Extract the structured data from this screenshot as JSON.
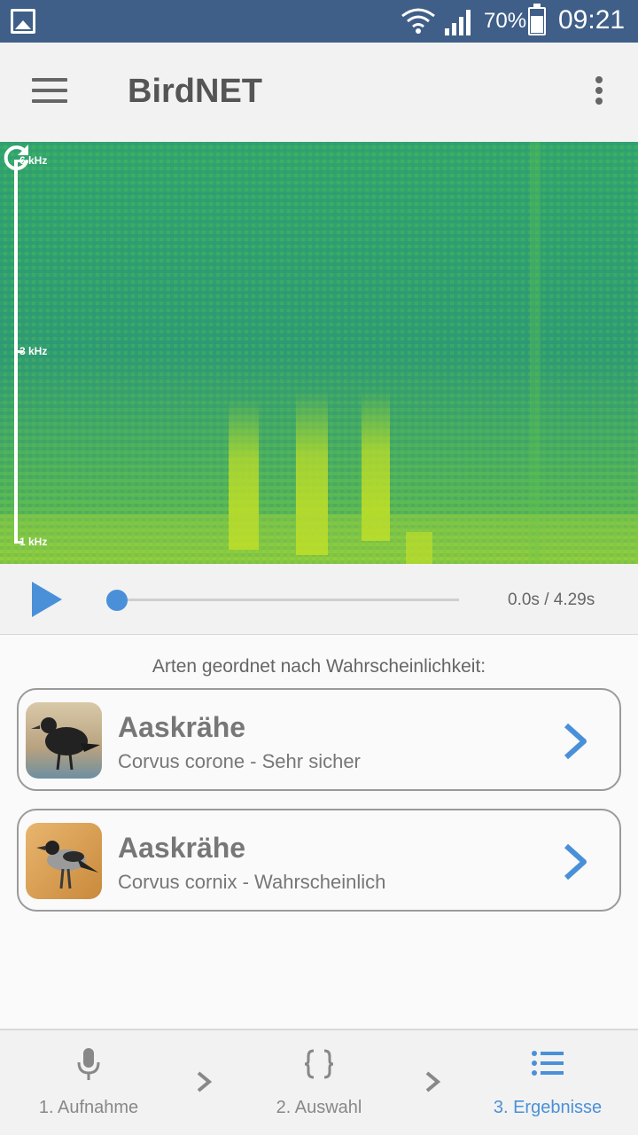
{
  "status_bar": {
    "battery": "70%",
    "time": "09:21"
  },
  "app_bar": {
    "title": "BirdNET"
  },
  "spectrogram": {
    "freq_labels": [
      "6 kHz",
      "3 kHz",
      "1 kHz"
    ]
  },
  "player": {
    "time": "0.0s / 4.29s",
    "progress": 0
  },
  "results": {
    "heading": "Arten geordnet nach Wahrscheinlichkeit:",
    "items": [
      {
        "name": "Aaskrähe",
        "detail": "Corvus corone - Sehr sicher"
      },
      {
        "name": "Aaskrähe",
        "detail": "Corvus cornix - Wahrscheinlich"
      }
    ]
  },
  "bottom_nav": {
    "items": [
      {
        "label": "1. Aufnahme",
        "icon": "microphone-icon"
      },
      {
        "label": "2. Auswahl",
        "icon": "braces-icon"
      },
      {
        "label": "3. Ergebnisse",
        "icon": "list-icon",
        "active": true
      }
    ]
  },
  "colors": {
    "accent": "#4a90d9",
    "status_bar": "#3f5f88",
    "spectrogram": "#39ad6a"
  }
}
